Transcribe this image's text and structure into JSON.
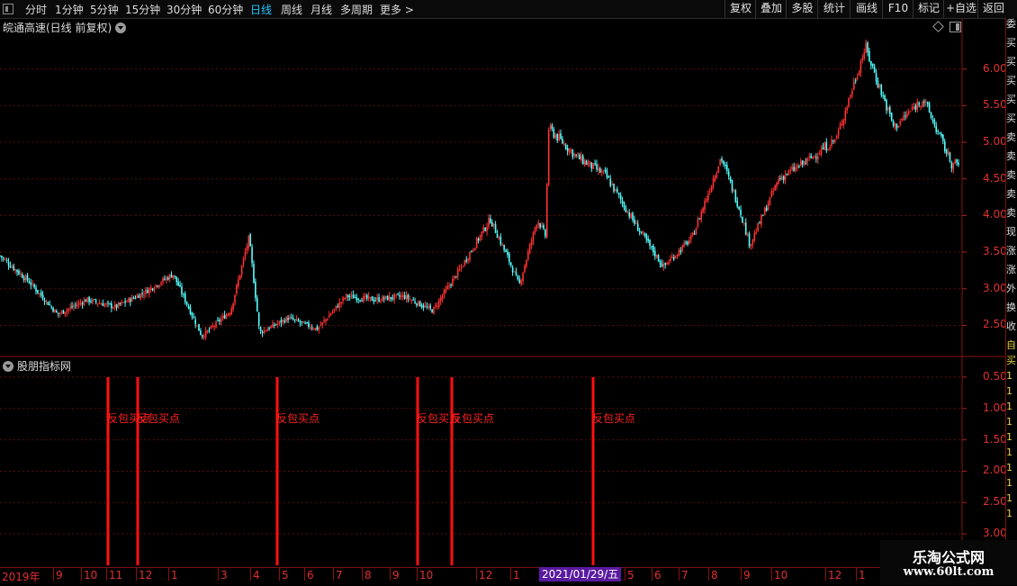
{
  "toolbar": {
    "periods": [
      "分时",
      "1分钟",
      "5分钟",
      "15分钟",
      "30分钟",
      "60分钟",
      "日线",
      "周线",
      "月线",
      "多周期",
      "更多 >"
    ],
    "active_period": "日线",
    "right_buttons": [
      "复权",
      "叠加",
      "多股",
      "统计",
      "画线",
      "F10",
      "标记",
      "+自选",
      "返回"
    ]
  },
  "main": {
    "title": "皖通高速(日线 前复权)",
    "y_ticks": [
      "6.00",
      "5.50",
      "5.00",
      "4.50",
      "4.00",
      "3.50",
      "3.00",
      "2.50"
    ]
  },
  "indicator": {
    "title": "股朋指标网",
    "y_ticks": [
      "3.00",
      "2.50",
      "2.00",
      "1.50",
      "1.00",
      "0.50"
    ]
  },
  "right_strip": [
    "委",
    "买",
    "买",
    "买",
    "买",
    "买",
    "卖",
    "卖",
    "卖",
    "卖",
    "卖",
    "现",
    "涨",
    "涨",
    "外",
    "换",
    "收"
  ],
  "right_strip_lower": [
    "自",
    "买",
    "1",
    "1",
    "1",
    "1",
    "1",
    "1",
    "1",
    "1",
    "1",
    "1"
  ],
  "x_axis": [
    "2019年",
    "9",
    "10",
    "11",
    "12",
    "1",
    "3",
    "4",
    "5",
    "6",
    "7",
    "8",
    "9",
    "10",
    "12",
    "1",
    "5",
    "6",
    "7",
    "8",
    "9",
    "10",
    "12",
    "1"
  ],
  "cursor_date": "2021/01/29/五",
  "watermark": {
    "line1": "乐淘公式网",
    "line2": "www.60lt.com"
  },
  "colors": {
    "up": "#ff3232",
    "down": "#54ffff",
    "signal": "#ff1010",
    "grid": "#6a1010",
    "tick": "#e03030"
  },
  "chart_data": [
    {
      "type": "candlestick",
      "title": "皖通高速(日线 前复权)",
      "ylim": [
        2.1,
        6.5
      ],
      "y_ticks": [
        2.5,
        3.0,
        3.5,
        4.0,
        4.5,
        5.0,
        5.5,
        6.0
      ],
      "approx_close_path": [
        {
          "x": "2019-07",
          "y": 3.45
        },
        {
          "x": "2019-08",
          "y": 3.1
        },
        {
          "x": "2019-09",
          "y": 2.65
        },
        {
          "x": "2019-10",
          "y": 2.85
        },
        {
          "x": "2019-11",
          "y": 2.75
        },
        {
          "x": "2019-12",
          "y": 2.95
        },
        {
          "x": "2020-01",
          "y": 3.2
        },
        {
          "x": "2020-02",
          "y": 2.35
        },
        {
          "x": "2020-03",
          "y": 2.7
        },
        {
          "x": "2020-03-20",
          "y": 3.7
        },
        {
          "x": "2020-04",
          "y": 2.4
        },
        {
          "x": "2020-05",
          "y": 2.6
        },
        {
          "x": "2020-06",
          "y": 2.45
        },
        {
          "x": "2020-07",
          "y": 2.9
        },
        {
          "x": "2020-08",
          "y": 2.85
        },
        {
          "x": "2020-09",
          "y": 2.9
        },
        {
          "x": "2020-10",
          "y": 2.7
        },
        {
          "x": "2020-11",
          "y": 3.3
        },
        {
          "x": "2020-12",
          "y": 3.95
        },
        {
          "x": "2020-12-20",
          "y": 3.4
        },
        {
          "x": "2021-01",
          "y": 3.05
        },
        {
          "x": "2021-01-20",
          "y": 3.95
        },
        {
          "x": "2021-01-29",
          "y": 3.7
        },
        {
          "x": "2021-02",
          "y": 5.2
        },
        {
          "x": "2021-03",
          "y": 4.8
        },
        {
          "x": "2021-04",
          "y": 4.55
        },
        {
          "x": "2021-05",
          "y": 3.9
        },
        {
          "x": "2021-06",
          "y": 3.3
        },
        {
          "x": "2021-07",
          "y": 3.7
        },
        {
          "x": "2021-08",
          "y": 4.8
        },
        {
          "x": "2021-08-20",
          "y": 4.1
        },
        {
          "x": "2021-09",
          "y": 3.6
        },
        {
          "x": "2021-10",
          "y": 4.5
        },
        {
          "x": "2021-11",
          "y": 4.75
        },
        {
          "x": "2021-12",
          "y": 5.05
        },
        {
          "x": "2022-01",
          "y": 6.3
        },
        {
          "x": "2022-02",
          "y": 5.2
        },
        {
          "x": "2022-03",
          "y": 5.6
        },
        {
          "x": "2022-04",
          "y": 4.7
        }
      ]
    },
    {
      "type": "bar",
      "title": "股朋指标网",
      "ylim": [
        0,
        3.3
      ],
      "y_ticks": [
        0.5,
        1.0,
        1.5,
        2.0,
        2.5,
        3.0
      ],
      "series": [
        {
          "name": "反包买点",
          "values": [
            3,
            3,
            3,
            3,
            3,
            3
          ]
        }
      ],
      "x": [
        "2019-11",
        "2019-12",
        "2020-05",
        "2020-10",
        "2020-11",
        "2021-01-29"
      ],
      "labels": [
        "反包买点",
        "反包买点",
        "反包买点",
        "反包买点",
        "反包买点",
        "反包买点"
      ]
    }
  ]
}
